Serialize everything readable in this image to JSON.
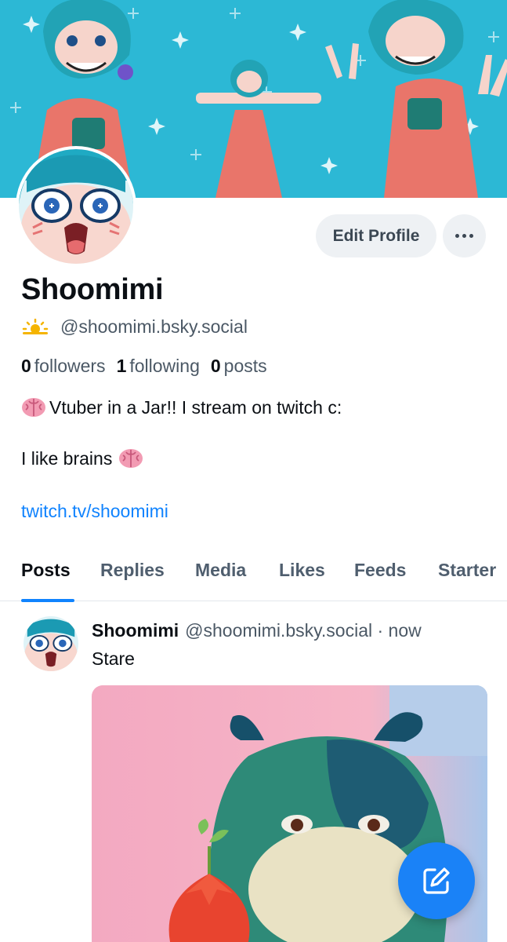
{
  "profile": {
    "display_name": "Shoomimi",
    "handle": "@shoomimi.bsky.social",
    "edit_label": "Edit Profile",
    "stats": {
      "followers_count": "0",
      "followers_label": "followers",
      "following_count": "1",
      "following_label": "following",
      "posts_count": "0",
      "posts_label": "posts"
    },
    "bio_line1": "Vtuber in a Jar!! I stream on twitch c:",
    "bio_line2": "I like brains",
    "bio_link": "twitch.tv/shoomimi"
  },
  "tabs": [
    "Posts",
    "Replies",
    "Media",
    "Likes",
    "Feeds",
    "Starter"
  ],
  "active_tab": "Posts",
  "post": {
    "author": "Shoomimi",
    "handle_time": "@shoomimi.bsky.social · now",
    "text": "Stare"
  },
  "icons": {
    "handle_badge": "sun-cloud-icon",
    "bio_emoji": "brain-icon",
    "more": "more-horizontal-icon",
    "compose": "compose-icon"
  },
  "colors": {
    "accent": "#1083fe",
    "banner": "#2bb6d3",
    "text_primary": "#0b0f14",
    "text_secondary": "#4b5865",
    "button_bg": "#eef1f4"
  }
}
